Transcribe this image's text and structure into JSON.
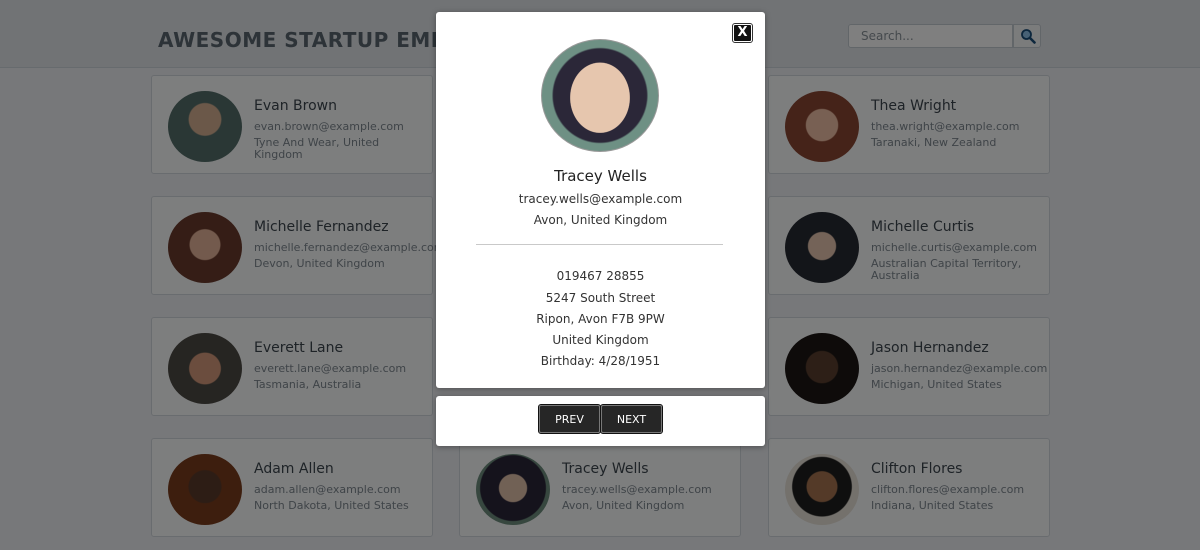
{
  "header": {
    "title": "AWESOME STARTUP EMPLOYEE DIRECTORY",
    "search_placeholder": "Search..."
  },
  "employees": [
    {
      "name": "Evan Brown",
      "email": "evan.brown@example.com",
      "location": "Tyne And Wear, United Kingdom"
    },
    {
      "name": "Thea Wright",
      "email": "thea.wright@example.com",
      "location": "Taranaki, New Zealand"
    },
    {
      "name": "Michelle Fernandez",
      "email": "michelle.fernandez@example.com",
      "location": "Devon, United Kingdom"
    },
    {
      "name": "Michelle Curtis",
      "email": "michelle.curtis@example.com",
      "location": "Australian Capital Territory, Australia"
    },
    {
      "name": "Everett Lane",
      "email": "everett.lane@example.com",
      "location": "Tasmania, Australia"
    },
    {
      "name": "Jason Hernandez",
      "email": "jason.hernandez@example.com",
      "location": "Michigan, United States"
    },
    {
      "name": "Adam Allen",
      "email": "adam.allen@example.com",
      "location": "North Dakota, United States"
    },
    {
      "name": "Tracey Wells",
      "email": "tracey.wells@example.com",
      "location": "Avon, United Kingdom"
    },
    {
      "name": "Clifton Flores",
      "email": "clifton.flores@example.com",
      "location": "Indiana, United States"
    }
  ],
  "modal": {
    "close_label": "X",
    "name": "Tracey Wells",
    "email": "tracey.wells@example.com",
    "location": "Avon, United Kingdom",
    "phone": "019467 28855",
    "street": "5247 South Street",
    "city_line": "Ripon, Avon F7B 9PW",
    "country": "United Kingdom",
    "birthday": "Birthday: 4/28/1951"
  },
  "nav": {
    "prev_label": "PREV",
    "next_label": "NEXT"
  },
  "colors": {
    "overlay": "#000000",
    "page_background": "#eef1f4",
    "button_dark": "#262626"
  },
  "icons": {
    "search": "magnifier-icon",
    "close": "close-icon"
  }
}
